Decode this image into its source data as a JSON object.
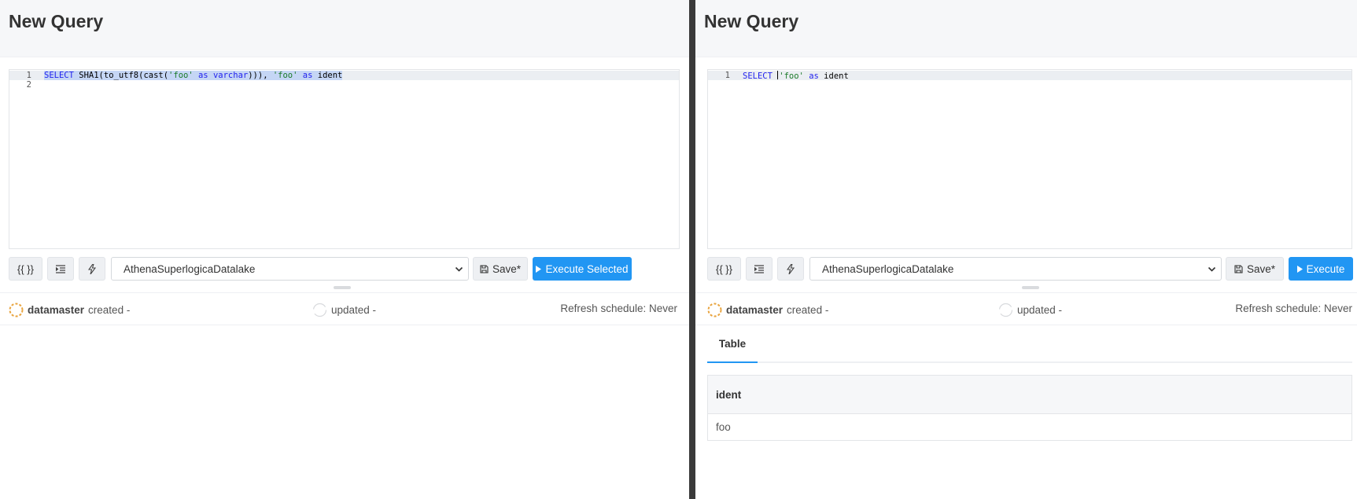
{
  "left": {
    "title": "New Query",
    "editor": {
      "line_numbers": [
        "1",
        "2"
      ],
      "tokens": {
        "t1": "SELECT",
        "t2": " SHA1(to_utf8(cast(",
        "t3": "'foo'",
        "t4": " ",
        "t5": "as",
        "t6": " ",
        "t7": "varchar",
        "t8": "))), ",
        "t9": "'foo'",
        "t10": " ",
        "t11": "as",
        "t12": " ident"
      }
    },
    "toolbar": {
      "params_label": "{{ }}",
      "data_source": "AthenaSuperlogicaDatalake",
      "save_label": "Save*",
      "execute_label": "Execute Selected"
    },
    "meta": {
      "user": "datamaster",
      "created": "created -",
      "updated": "updated -",
      "refresh": "Refresh schedule: Never"
    }
  },
  "right": {
    "title": "New Query",
    "editor": {
      "line_numbers": [
        "1"
      ],
      "tokens": {
        "t1": "SELECT",
        "t2": " ",
        "t3": "'foo'",
        "t4": " ",
        "t5": "as",
        "t6": " ident"
      }
    },
    "toolbar": {
      "params_label": "{{ }}",
      "data_source": "AthenaSuperlogicaDatalake",
      "save_label": "Save*",
      "execute_label": "Execute"
    },
    "meta": {
      "user": "datamaster",
      "created": "created -",
      "updated": "updated -",
      "refresh": "Refresh schedule: Never"
    },
    "results": {
      "tab_label": "Table",
      "columns": [
        "ident"
      ],
      "rows": [
        [
          "foo"
        ]
      ]
    }
  },
  "colors": {
    "accent": "#2196f3",
    "divider": "#3a3a3a",
    "avatar_ring": "#e8a33d"
  }
}
